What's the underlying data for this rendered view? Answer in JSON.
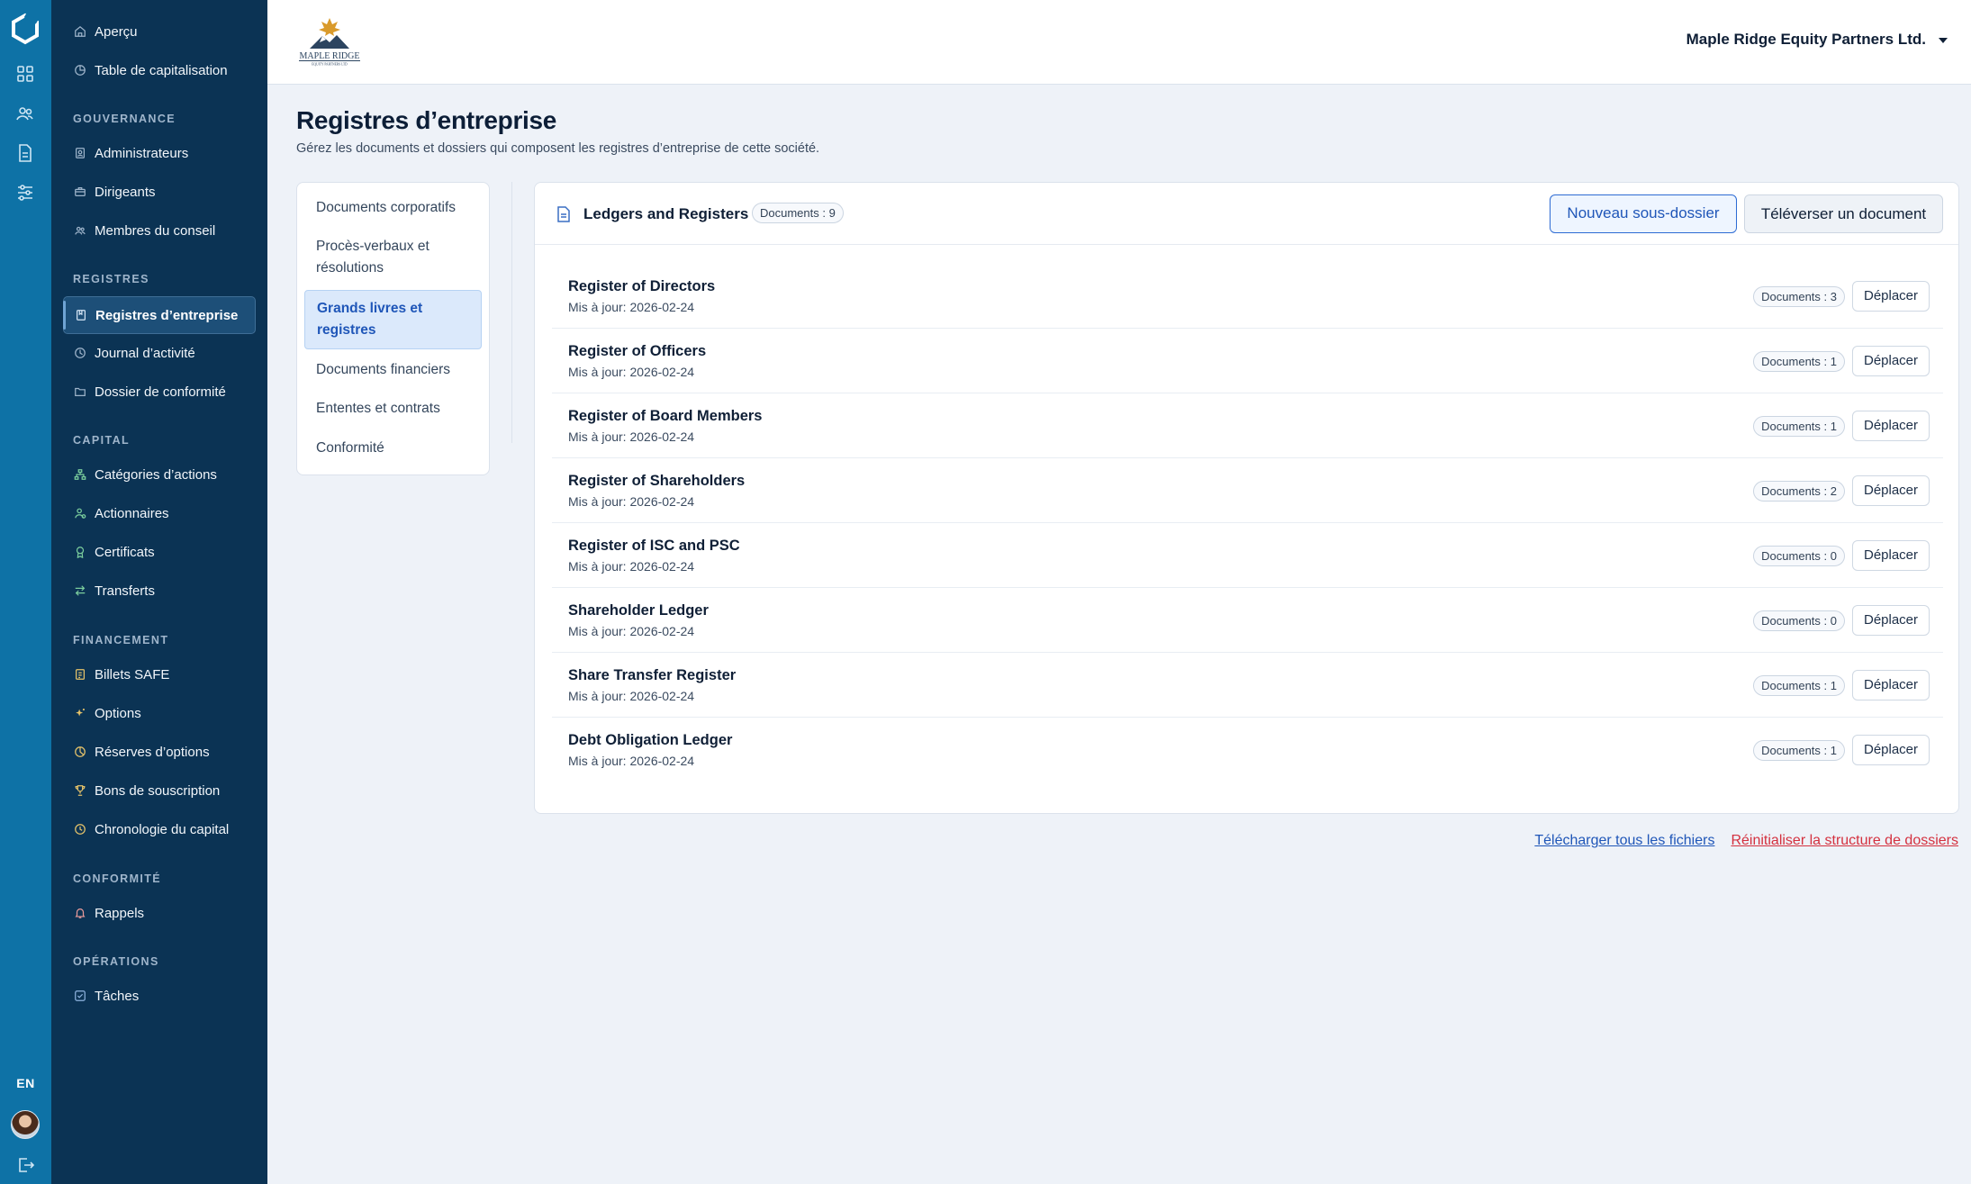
{
  "sidebar": {
    "items_top": [
      {
        "label": "Aperçu",
        "icon": "home-icon"
      },
      {
        "label": "Table de capitalisation",
        "icon": "pie-chart-icon"
      }
    ],
    "sections": [
      {
        "title": "GOUVERNANCE",
        "items": [
          {
            "label": "Administrateurs",
            "icon": "id-badge-icon"
          },
          {
            "label": "Dirigeants",
            "icon": "briefcase-icon"
          },
          {
            "label": "Membres du conseil",
            "icon": "users-icon"
          }
        ]
      },
      {
        "title": "REGISTRES",
        "items": [
          {
            "label": "Registres d’entreprise",
            "icon": "book-icon",
            "active": true
          },
          {
            "label": "Journal d’activité",
            "icon": "clock-icon"
          },
          {
            "label": "Dossier de conformité",
            "icon": "folder-icon"
          }
        ]
      },
      {
        "title": "CAPITAL",
        "items": [
          {
            "label": "Catégories d’actions",
            "icon": "hierarchy-icon"
          },
          {
            "label": "Actionnaires",
            "icon": "shareholder-icon"
          },
          {
            "label": "Certificats",
            "icon": "award-icon"
          },
          {
            "label": "Transferts",
            "icon": "transfer-icon"
          }
        ]
      },
      {
        "title": "FINANCEMENT",
        "items": [
          {
            "label": "Billets SAFE",
            "icon": "note-icon"
          },
          {
            "label": "Options",
            "icon": "sparkle-icon"
          },
          {
            "label": "Réserves d’options",
            "icon": "pie-icon"
          },
          {
            "label": "Bons de souscription",
            "icon": "trophy-icon"
          },
          {
            "label": "Chronologie du capital",
            "icon": "history-icon"
          }
        ]
      },
      {
        "title": "CONFORMITÉ",
        "items": [
          {
            "label": "Rappels",
            "icon": "bell-icon"
          }
        ]
      },
      {
        "title": "OPÉRATIONS",
        "items": [
          {
            "label": "Tâches",
            "icon": "checkbox-icon"
          }
        ]
      }
    ]
  },
  "rail": {
    "lang": "EN"
  },
  "header": {
    "company": "Maple Ridge Equity Partners Ltd.",
    "brand_logo_text": "MAPLE RIDGE",
    "brand_logo_subtext": "EQUITY PARTNERS LTD"
  },
  "page": {
    "title": "Registres d’entreprise",
    "subtitle": "Gérez les documents et dossiers qui composent les registres d’entreprise de cette société."
  },
  "categories": [
    "Documents corporatifs",
    "Procès-verbaux et résolutions",
    "Grands livres et registres",
    "Documents financiers",
    "Ententes et contrats",
    "Conformité"
  ],
  "categories_active_index": 2,
  "folder": {
    "title": "Ledgers and Registers",
    "count_label": "Documents : 9",
    "new_subfolder": "Nouveau sous-dossier",
    "upload": "Téléverser un document",
    "move_label": "Déplacer",
    "rows": [
      {
        "name": "Register of Directors",
        "updated": "Mis à jour: 2026-02-24",
        "count": "Documents : 3"
      },
      {
        "name": "Register of Officers",
        "updated": "Mis à jour: 2026-02-24",
        "count": "Documents : 1"
      },
      {
        "name": "Register of Board Members",
        "updated": "Mis à jour: 2026-02-24",
        "count": "Documents : 1"
      },
      {
        "name": "Register of Shareholders",
        "updated": "Mis à jour: 2026-02-24",
        "count": "Documents : 2"
      },
      {
        "name": "Register of ISC and PSC",
        "updated": "Mis à jour: 2026-02-24",
        "count": "Documents : 0"
      },
      {
        "name": "Shareholder Ledger",
        "updated": "Mis à jour: 2026-02-24",
        "count": "Documents : 0"
      },
      {
        "name": "Share Transfer Register",
        "updated": "Mis à jour: 2026-02-24",
        "count": "Documents : 1"
      },
      {
        "name": "Debt Obligation Ledger",
        "updated": "Mis à jour: 2026-02-24",
        "count": "Documents : 1"
      }
    ]
  },
  "footer_links": {
    "download_all": "Télécharger tous les fichiers",
    "reset_structure": "Réinitialiser la structure de dossiers"
  },
  "colors": {
    "rail": "#0e72a6",
    "sidebar": "#0b3354",
    "accent": "#1f56b8",
    "danger": "#d4313f"
  }
}
